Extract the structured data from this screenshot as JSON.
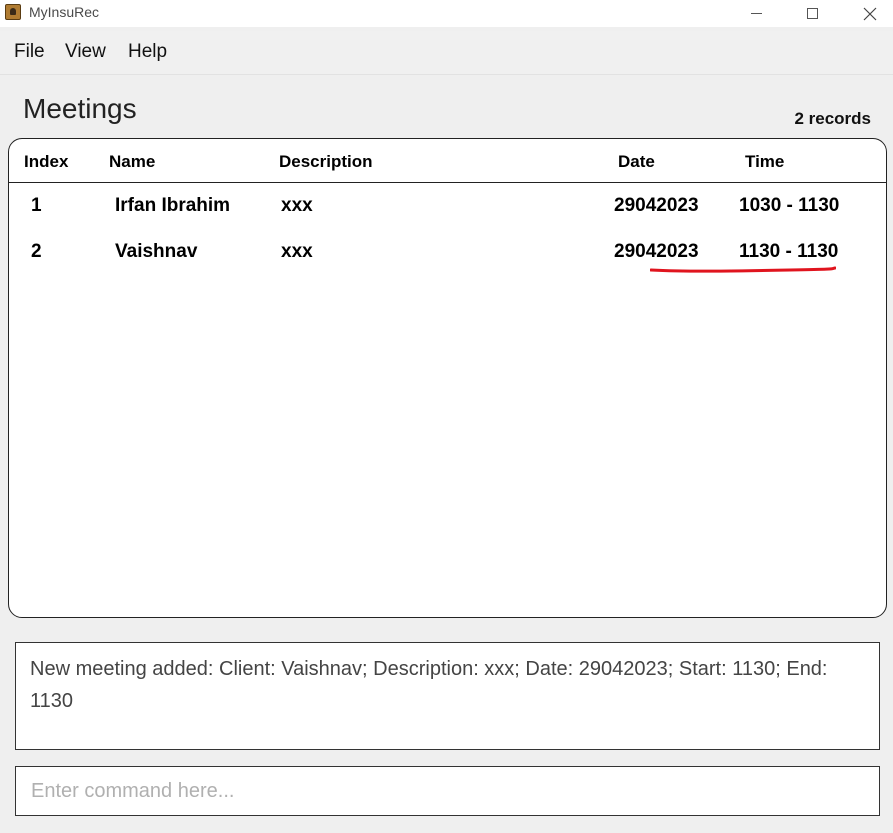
{
  "window": {
    "title": "MyInsuRec",
    "icon": "app-contact-icon"
  },
  "menu": {
    "items": [
      {
        "label": "File"
      },
      {
        "label": "View"
      },
      {
        "label": "Help"
      }
    ]
  },
  "header": {
    "title": "Meetings",
    "record_count": "2 records"
  },
  "table": {
    "columns": [
      "Index",
      "Name",
      "Description",
      "Date",
      "Time"
    ],
    "rows": [
      {
        "index": "1",
        "name": "Irfan Ibrahim",
        "description": "xxx",
        "date": "29042023",
        "time": "1030 - 1130"
      },
      {
        "index": "2",
        "name": "Vaishnav",
        "description": "xxx",
        "date": "29042023",
        "time": "1130 - 1130"
      }
    ]
  },
  "result": {
    "text": "New meeting added: Client: Vaishnav; Description: xxx; Date: 29042023; Start: 1130; End: 1130"
  },
  "command": {
    "placeholder": "Enter command here...",
    "value": ""
  },
  "colors": {
    "annotation_underline": "#e0141e"
  }
}
